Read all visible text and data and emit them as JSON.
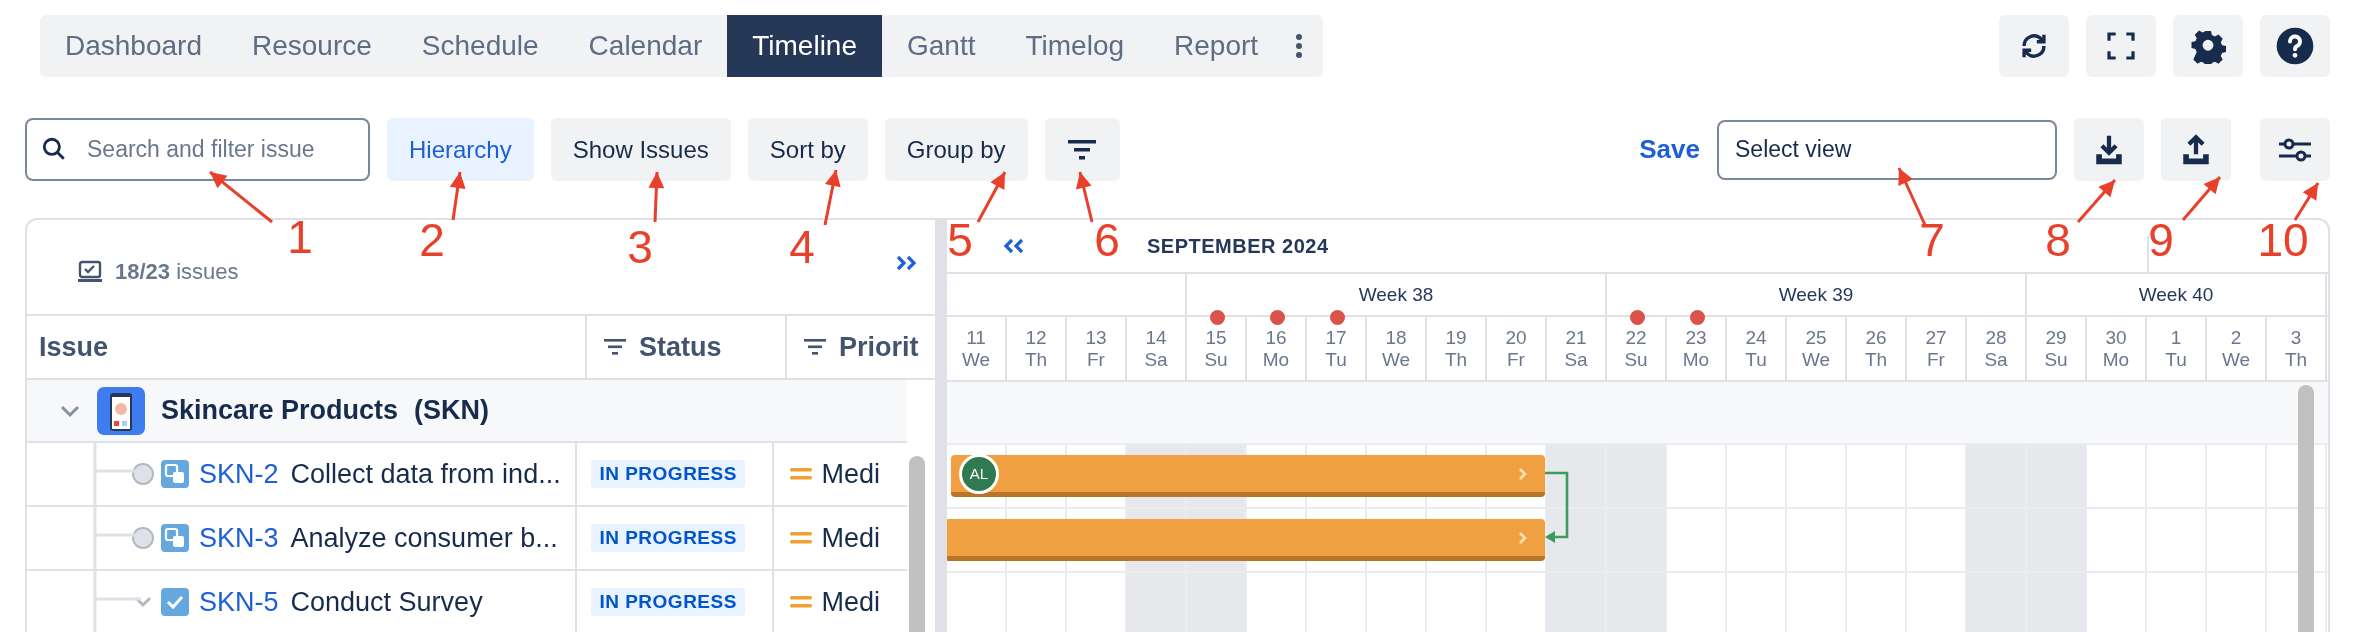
{
  "tabs": [
    {
      "label": "Dashboard",
      "selected": false
    },
    {
      "label": "Resource",
      "selected": false
    },
    {
      "label": "Schedule",
      "selected": false
    },
    {
      "label": "Calendar",
      "selected": false
    },
    {
      "label": "Timeline",
      "selected": true
    },
    {
      "label": "Gantt",
      "selected": false
    },
    {
      "label": "Timelog",
      "selected": false
    },
    {
      "label": "Report",
      "selected": false
    }
  ],
  "search": {
    "placeholder": "Search and filter issue"
  },
  "toolbar_buttons": [
    {
      "label": "Hierarchy",
      "selected": true
    },
    {
      "label": "Show Issues",
      "selected": false
    },
    {
      "label": "Sort by",
      "selected": false
    },
    {
      "label": "Group by",
      "selected": false
    }
  ],
  "save": "Save",
  "view_select": {
    "placeholder": "Select view"
  },
  "issue_count": {
    "count": "18/23",
    "label": "issues"
  },
  "columns": [
    {
      "label": "Issue",
      "filter": false
    },
    {
      "label": "Status",
      "filter": true
    },
    {
      "label": "Priorit",
      "filter": true
    }
  ],
  "project": {
    "name": "Skincare Products",
    "key": "(SKN)",
    "expanded": true
  },
  "rows": [
    {
      "kind": "subtask",
      "key": "SKN-2",
      "summary": "Collect data from ind...",
      "status": "IN PROGRESS",
      "priority": "Medi",
      "bar": true,
      "assignee": "AL",
      "links_to_next": true
    },
    {
      "kind": "subtask",
      "key": "SKN-3",
      "summary": "Analyze consumer b...",
      "status": "IN PROGRESS",
      "priority": "Medi",
      "bar": true,
      "links_to_next": false
    },
    {
      "kind": "task",
      "key": "SKN-5",
      "summary": "Conduct Survey",
      "status": "IN PROGRESS",
      "priority": "Medi",
      "expanded": true,
      "bar": false,
      "links_to_next": false
    }
  ],
  "timeline": {
    "month": "SEPTEMBER 2024",
    "weeks": [
      {
        "label": "Week 38"
      },
      {
        "label": "Week 39"
      },
      {
        "label": "Week 40"
      }
    ],
    "days": [
      {
        "num": "11",
        "dow": "We",
        "weekend": false,
        "marked": false
      },
      {
        "num": "12",
        "dow": "Th",
        "weekend": false,
        "marked": false
      },
      {
        "num": "13",
        "dow": "Fr",
        "weekend": false,
        "marked": false
      },
      {
        "num": "14",
        "dow": "Sa",
        "weekend": true,
        "marked": false
      },
      {
        "num": "15",
        "dow": "Su",
        "weekend": true,
        "marked": true
      },
      {
        "num": "16",
        "dow": "Mo",
        "weekend": false,
        "marked": true
      },
      {
        "num": "17",
        "dow": "Tu",
        "weekend": false,
        "marked": true
      },
      {
        "num": "18",
        "dow": "We",
        "weekend": false,
        "marked": false
      },
      {
        "num": "19",
        "dow": "Th",
        "weekend": false,
        "marked": false
      },
      {
        "num": "20",
        "dow": "Fr",
        "weekend": false,
        "marked": false
      },
      {
        "num": "21",
        "dow": "Sa",
        "weekend": true,
        "marked": false
      },
      {
        "num": "22",
        "dow": "Su",
        "weekend": true,
        "marked": true
      },
      {
        "num": "23",
        "dow": "Mo",
        "weekend": false,
        "marked": true
      },
      {
        "num": "24",
        "dow": "Tu",
        "weekend": false,
        "marked": false
      },
      {
        "num": "25",
        "dow": "We",
        "weekend": false,
        "marked": false
      },
      {
        "num": "26",
        "dow": "Th",
        "weekend": false,
        "marked": false
      },
      {
        "num": "27",
        "dow": "Fr",
        "weekend": false,
        "marked": false
      },
      {
        "num": "28",
        "dow": "Sa",
        "weekend": true,
        "marked": false
      },
      {
        "num": "29",
        "dow": "Su",
        "weekend": true,
        "marked": false
      },
      {
        "num": "30",
        "dow": "Mo",
        "weekend": false,
        "marked": false
      },
      {
        "num": "1",
        "dow": "Tu",
        "weekend": false,
        "marked": false
      },
      {
        "num": "2",
        "dow": "We",
        "weekend": false,
        "marked": false
      },
      {
        "num": "3",
        "dow": "Th",
        "weekend": false,
        "marked": false
      }
    ]
  },
  "annotations": [
    {
      "label": "1"
    },
    {
      "label": "2"
    },
    {
      "label": "3"
    },
    {
      "label": "4"
    },
    {
      "label": "5"
    },
    {
      "label": "6"
    },
    {
      "label": "7"
    },
    {
      "label": "8"
    },
    {
      "label": "9"
    },
    {
      "label": "10"
    }
  ]
}
